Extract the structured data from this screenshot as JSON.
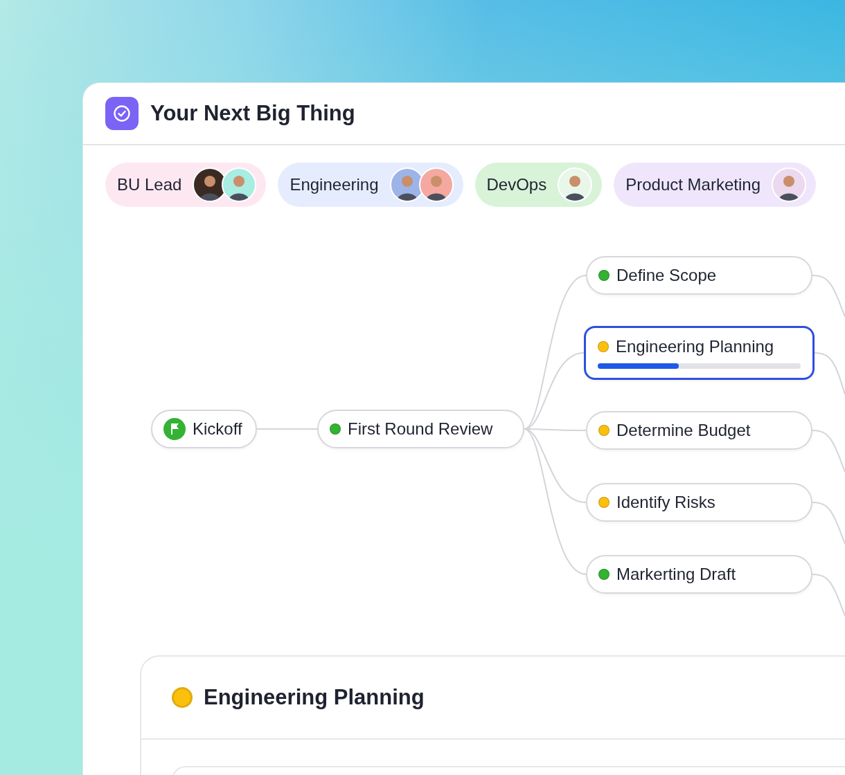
{
  "window": {
    "title": "Your Next Big Thing"
  },
  "teams": [
    {
      "label": "BU Lead",
      "color": "#fde8f2",
      "avatars": [
        {
          "color": "#3a2a22"
        },
        {
          "color": "#a8ece2"
        }
      ]
    },
    {
      "label": "Engineering",
      "color": "#e5ecfd",
      "avatars": [
        {
          "color": "#9db4e8"
        },
        {
          "color": "#f4a8a0"
        }
      ]
    },
    {
      "label": "DevOps",
      "color": "#d8f3d8",
      "avatars": [
        {
          "color": "#e9f7ea"
        }
      ]
    },
    {
      "label": "Product Marketing",
      "color": "#efe6fc",
      "avatars": [
        {
          "color": "#ecd8ef"
        }
      ]
    }
  ],
  "flow": {
    "nodes": [
      {
        "kind": "start",
        "label": "Kickoff",
        "color": "#34b233",
        "selected": false
      },
      {
        "kind": "task",
        "label": "First Round Review",
        "color": "#34b233",
        "selected": false
      },
      {
        "kind": "task",
        "label": "Define Scope",
        "color": "#34b233",
        "selected": false
      },
      {
        "kind": "task",
        "label": "Engineering Planning",
        "color": "#fbbf0e",
        "selected": true,
        "level": 0.4
      },
      {
        "kind": "task",
        "label": "Determine Budget",
        "color": "#fbbf0e",
        "selected": false
      },
      {
        "kind": "task",
        "label": "Identify Risks",
        "color": "#fbbf0e",
        "selected": false
      },
      {
        "kind": "task",
        "label": "Markerting Draft",
        "color": "#34b233",
        "selected": false
      }
    ]
  },
  "detail": {
    "title": "Engineering Planning",
    "color": "#fbbf0e"
  }
}
